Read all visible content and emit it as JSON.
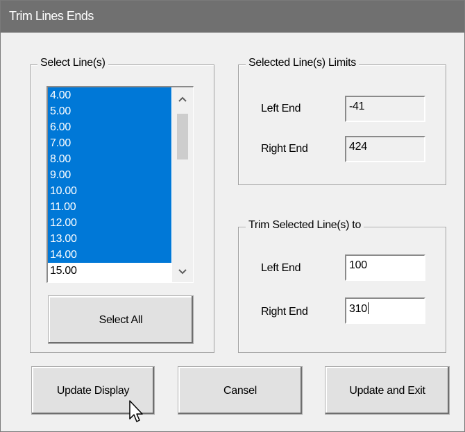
{
  "window": {
    "title": "Trim Lines Ends"
  },
  "select_lines": {
    "legend": "Select Line(s)",
    "items": [
      {
        "label": "4.00",
        "selected": true
      },
      {
        "label": "5.00",
        "selected": true
      },
      {
        "label": "6.00",
        "selected": true
      },
      {
        "label": "7.00",
        "selected": true
      },
      {
        "label": "8.00",
        "selected": true
      },
      {
        "label": "9.00",
        "selected": true
      },
      {
        "label": "10.00",
        "selected": true
      },
      {
        "label": "11.00",
        "selected": true
      },
      {
        "label": "12.00",
        "selected": true
      },
      {
        "label": "13.00",
        "selected": true
      },
      {
        "label": "14.00",
        "selected": true
      },
      {
        "label": "15.00",
        "selected": false
      }
    ],
    "select_all_label": "Select All"
  },
  "limits": {
    "legend": "Selected Line(s) Limits",
    "left_label": "Left End",
    "left_value": "-41",
    "right_label": "Right End",
    "right_value": "424"
  },
  "trim": {
    "legend": "Trim Selected Line(s) to",
    "left_label": "Left End",
    "left_value": "100",
    "right_label": "Right End",
    "right_value": "310"
  },
  "buttons": {
    "update_display": "Update Display",
    "cancel": "Cansel",
    "update_exit": "Update and Exit"
  },
  "icons": {
    "scroll_up": "chevron-up-icon",
    "scroll_down": "chevron-down-icon",
    "cursor": "mouse-pointer-icon"
  },
  "colors": {
    "selection": "#0078d7",
    "titlebar": "#707070",
    "dialog_bg": "#f0f0f0"
  }
}
